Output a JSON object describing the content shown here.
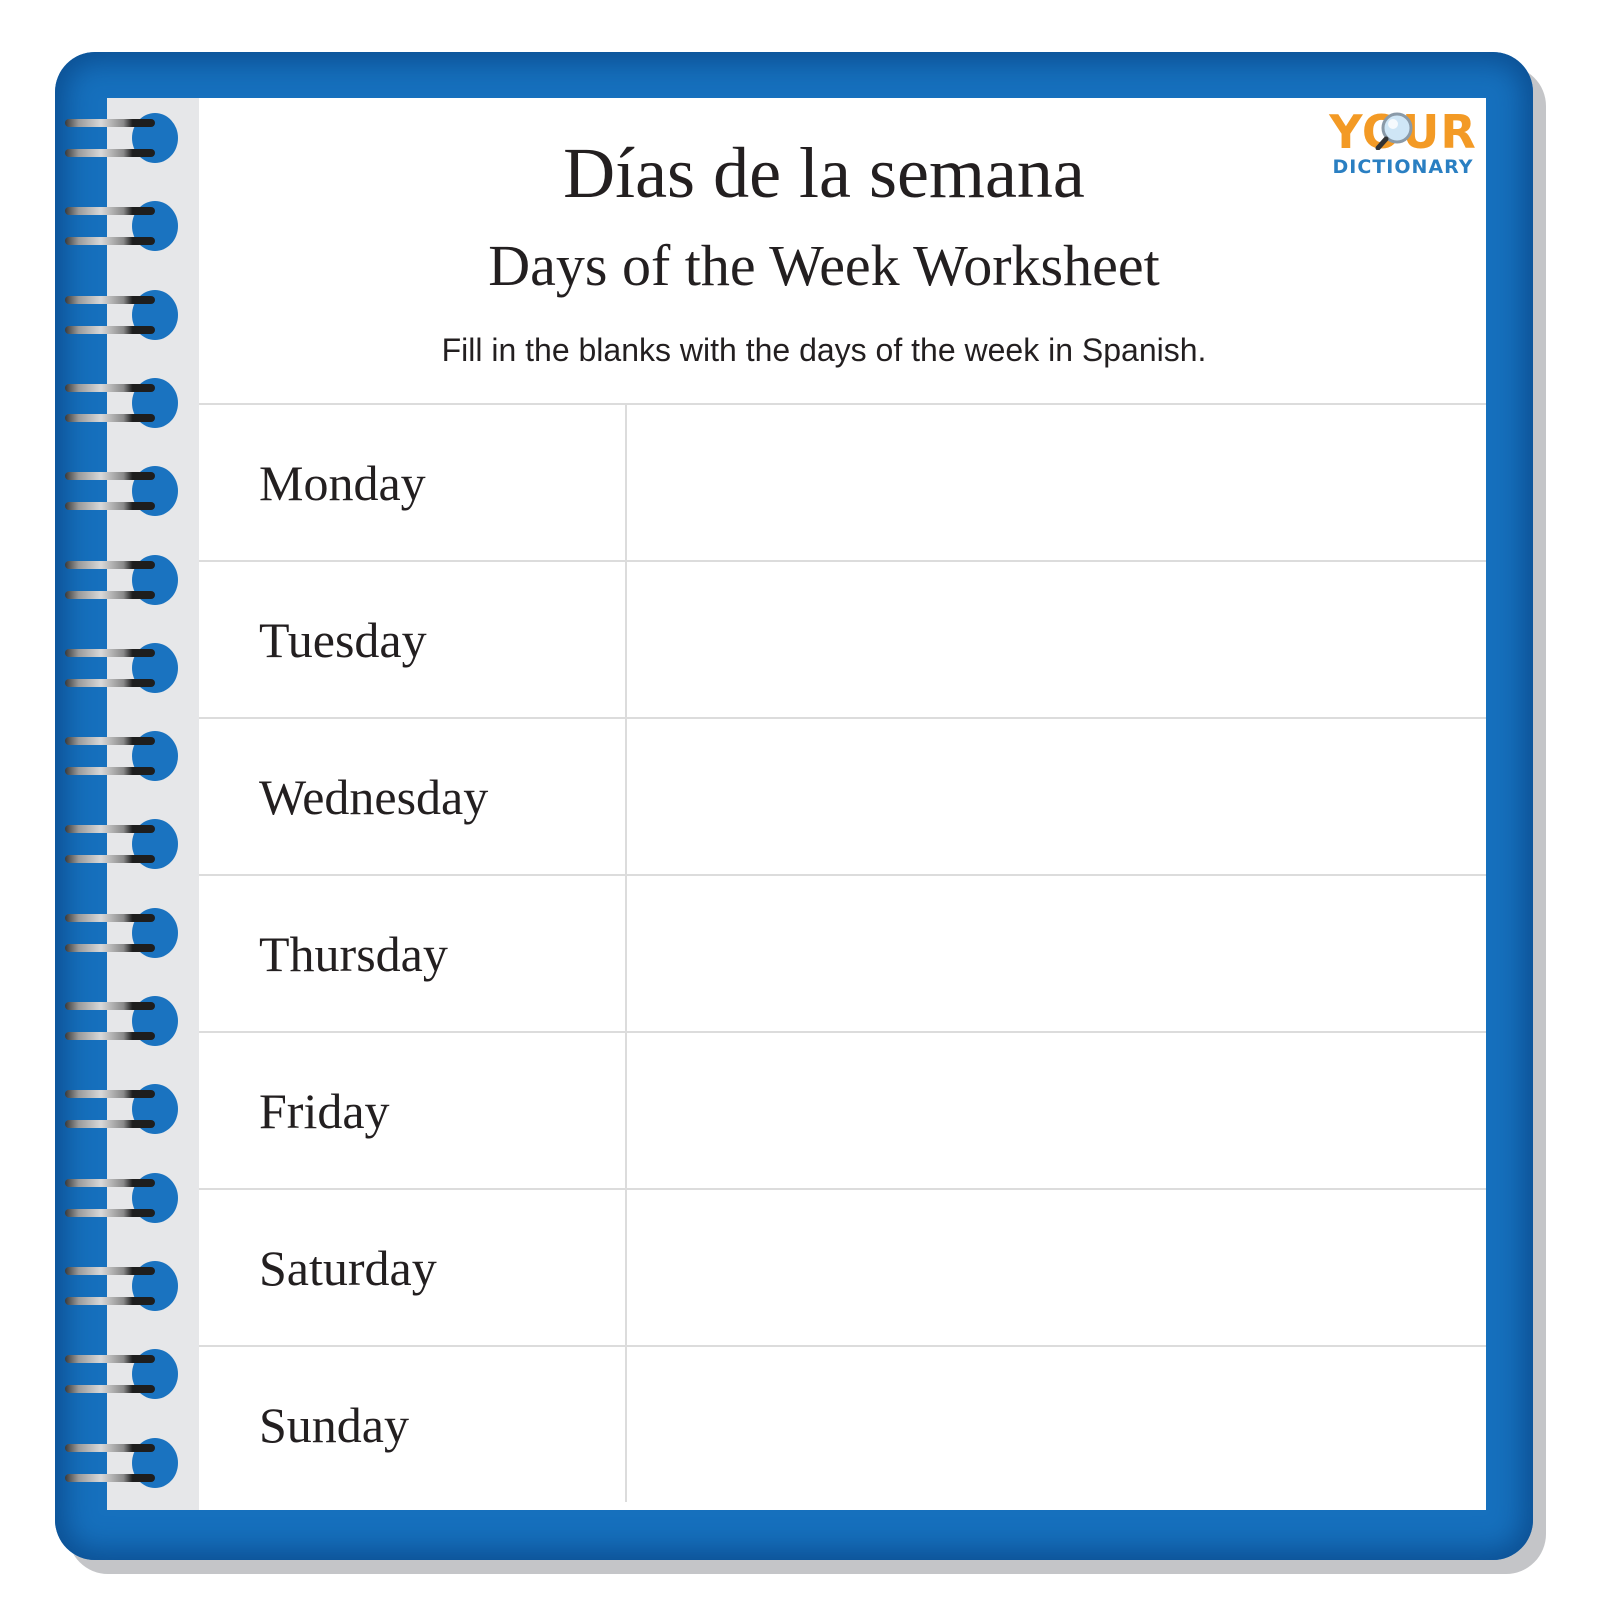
{
  "worksheet": {
    "title": "Días de la semana",
    "subtitle": "Days of the Week Worksheet",
    "instructions": "Fill in the blanks with the days of the week in Spanish."
  },
  "logo": {
    "top": "YOUR",
    "bottom": "DICTIONARY",
    "icon": "magnifier-icon"
  },
  "colors": {
    "binder_blue": "#1670bd",
    "logo_orange": "#f39a25",
    "logo_blue": "#2a7fc2"
  },
  "rows": [
    {
      "day": "Monday",
      "answer": ""
    },
    {
      "day": "Tuesday",
      "answer": ""
    },
    {
      "day": "Wednesday",
      "answer": ""
    },
    {
      "day": "Thursday",
      "answer": ""
    },
    {
      "day": "Friday",
      "answer": ""
    },
    {
      "day": "Saturday",
      "answer": ""
    },
    {
      "day": "Sunday",
      "answer": ""
    }
  ]
}
